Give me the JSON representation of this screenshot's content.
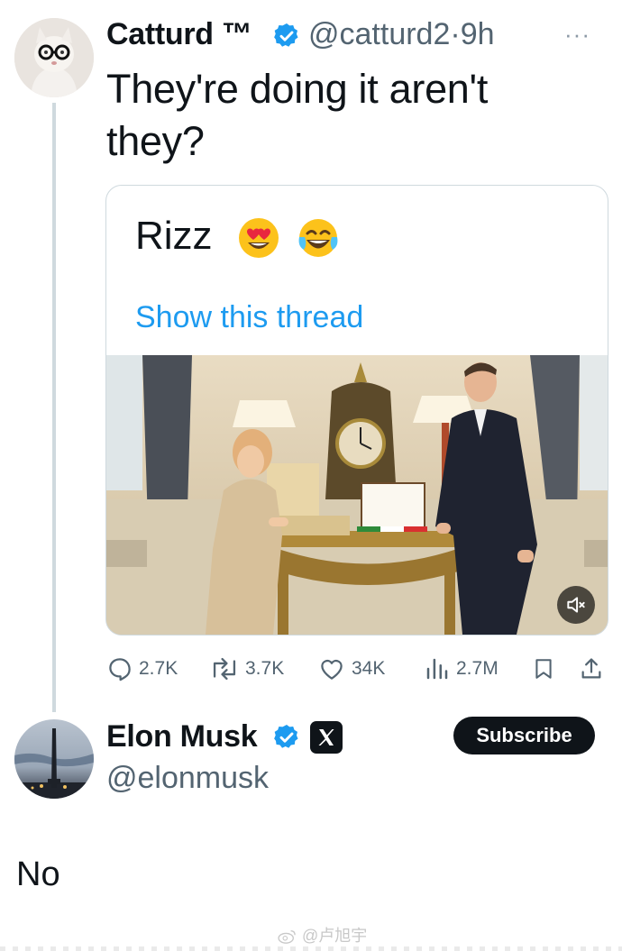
{
  "tweet": {
    "author_name": "Catturd ™",
    "author_handle": "@catturd2",
    "separator": "·",
    "time": "9h",
    "more_label": "···",
    "text": "They're doing it aren't they?",
    "quote": {
      "text": "Rizz",
      "emojis": [
        "heart-eyes-emoji",
        "tears-of-joy-emoji"
      ],
      "show_thread": "Show this thread"
    },
    "stats": {
      "replies": "2.7K",
      "reposts": "3.7K",
      "likes": "34K",
      "views": "2.7M"
    }
  },
  "reply": {
    "author_name": "Elon Musk",
    "author_handle": "@elonmusk",
    "subscribe_label": "Subscribe",
    "text": "No"
  },
  "watermark": "@卢旭宇",
  "colors": {
    "link": "#1d9bf0",
    "verified": "#1d9bf0",
    "muted_text": "#536471",
    "border": "#cfd9de",
    "text": "#0f1419"
  }
}
